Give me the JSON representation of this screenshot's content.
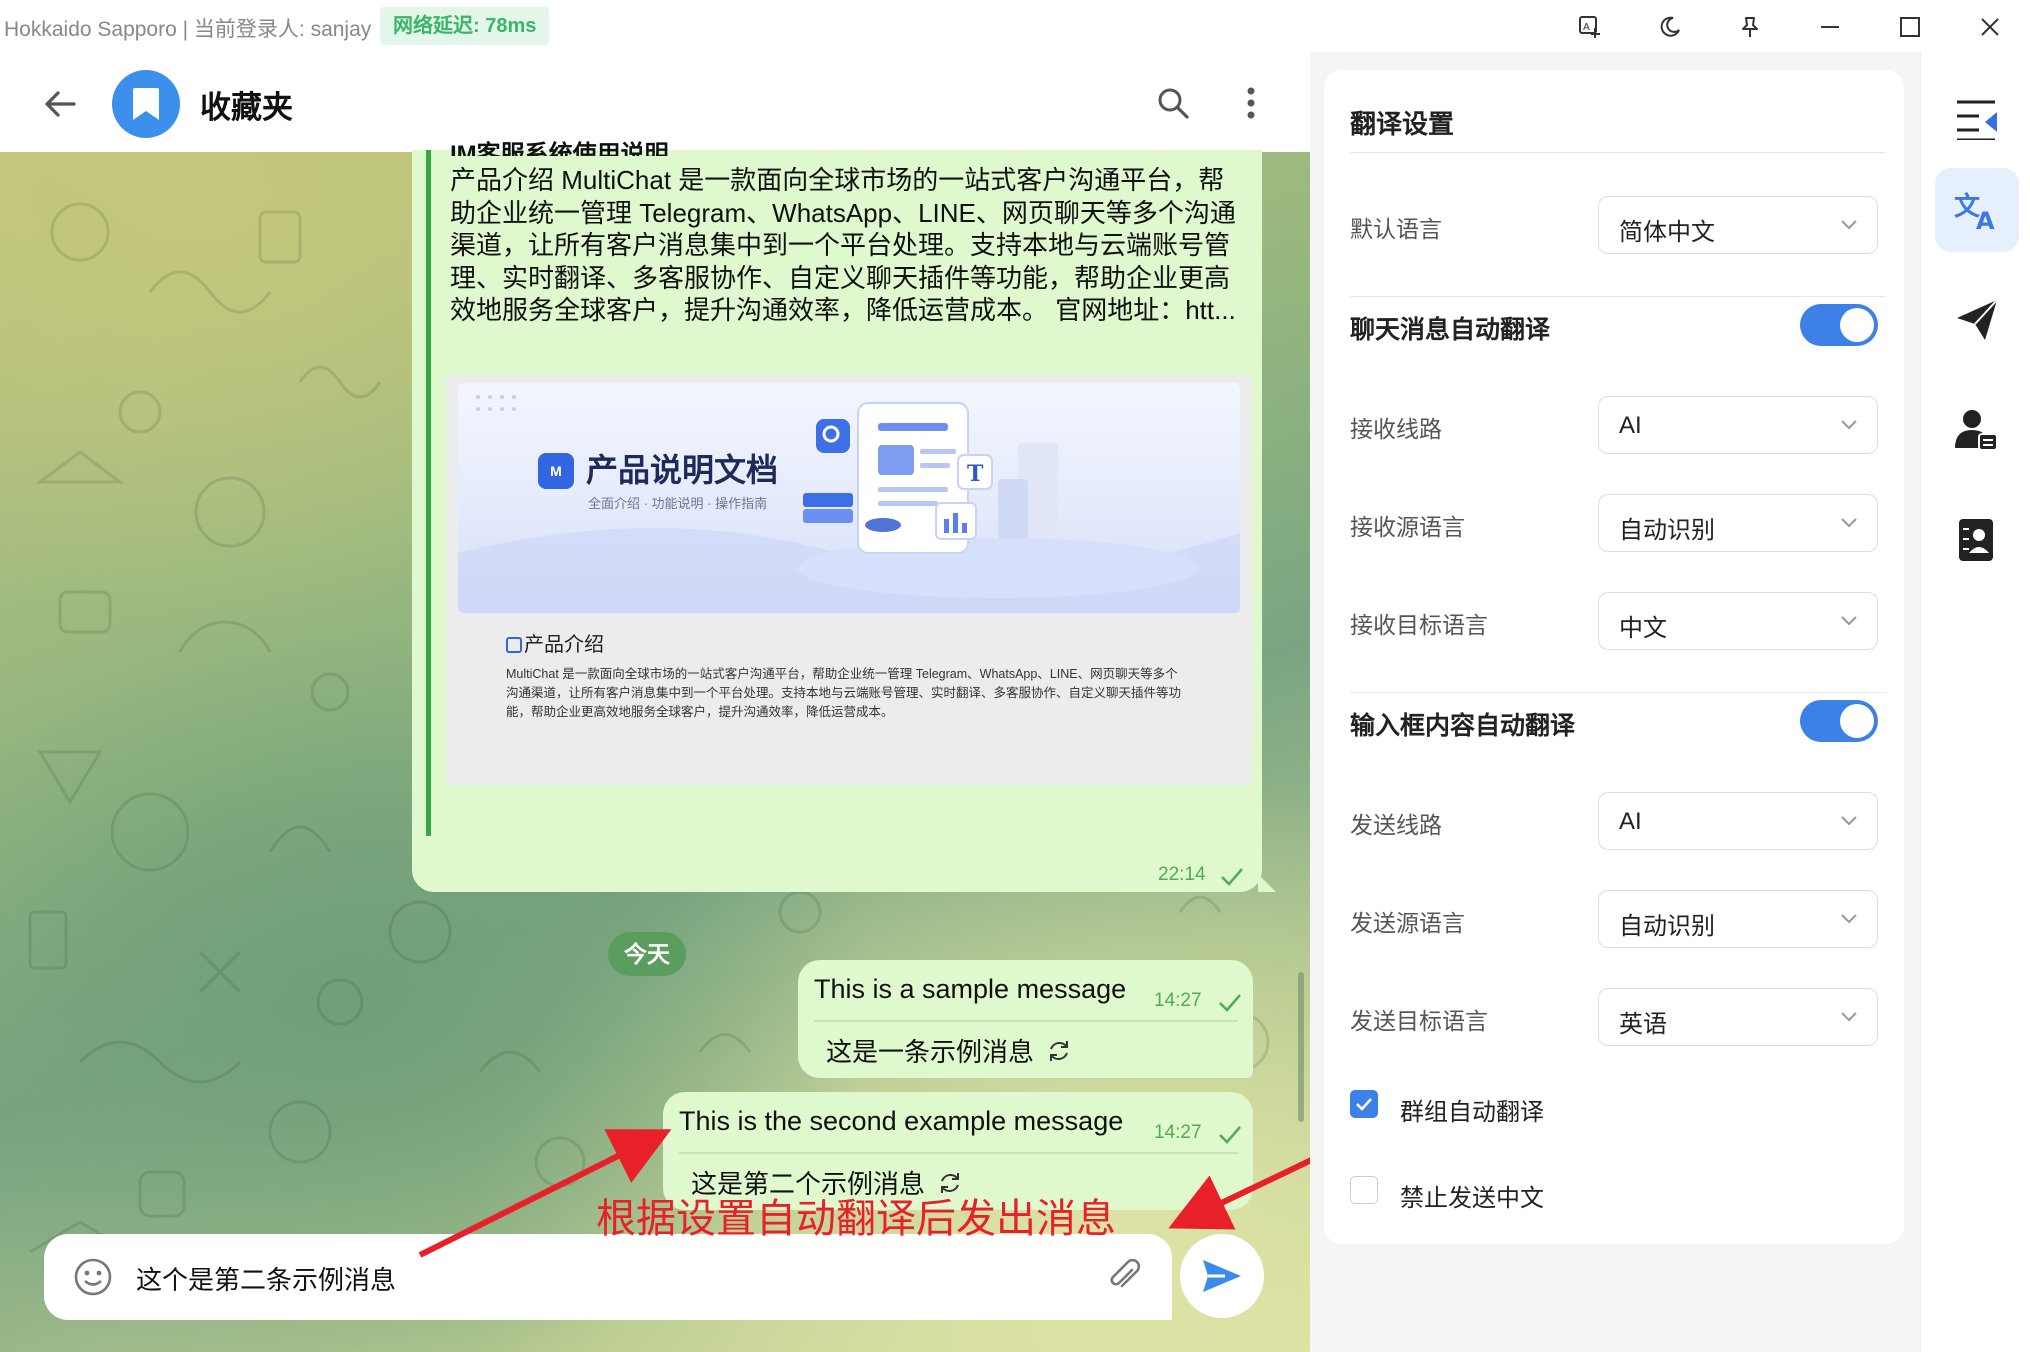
{
  "titlebar": {
    "text": "Hokkaido Sapporo | 当前登录人: sanjay",
    "latency": "网络延迟: 78ms",
    "icons": [
      "translate-window-icon",
      "moon-icon",
      "pin-icon",
      "minimize-icon",
      "maximize-icon",
      "close-icon"
    ]
  },
  "chat": {
    "title": "收藏夹",
    "avatar_icon": "bookmark-icon",
    "header_actions": [
      "search-icon",
      "more-vertical-icon"
    ],
    "pinned_message": {
      "cut_text": "IM客服系统使用说明",
      "text": "产品介绍 MultiChat 是一款面向全球市场的一站式客户沟通平台，帮助企业统一管理 Telegram、WhatsApp、LINE、网页聊天等多个沟通渠道，让所有客户消息集中到一个平台处理。支持本地与云端账号管理、实时翻译、多客服协作、自定义聊天插件等功能，帮助企业更高效地服务全球客户，提升沟通效率，降低运营成本。 官网地址：htt...",
      "doc": {
        "logo": "M",
        "title": "产品说明文档",
        "subtitle": "全面介绍 · 功能说明 · 操作指南",
        "section": "产品介绍",
        "desc": "MultiChat 是一款面向全球市场的一站式客户沟通平台，帮助企业统一管理 Telegram、WhatsApp、LINE、网页聊天等多个沟通渠道，让所有客户消息集中到一个平台处理。支持本地与云端账号管理、实时翻译、多客服协作、自定义聊天插件等功能，帮助企业更高效地服务全球客户，提升沟通效率，降低运营成本。"
      },
      "time": "22:14"
    },
    "date_divider": "今天",
    "messages": [
      {
        "text": "This is a sample message",
        "translation": "这是一条示例消息",
        "time": "14:27"
      },
      {
        "text": "This is the second example message",
        "translation": "这是第二个示例消息",
        "time": "14:27"
      }
    ],
    "input": {
      "value": "这个是第二条示例消息"
    },
    "annotation": "根据设置自动翻译后发出消息"
  },
  "settings": {
    "title": "翻译设置",
    "default_language": {
      "label": "默认语言",
      "value": "简体中文"
    },
    "chat_auto_translate": {
      "label": "聊天消息自动翻译",
      "on": true
    },
    "receive_route": {
      "label": "接收线路",
      "value": "AI"
    },
    "receive_source": {
      "label": "接收源语言",
      "value": "自动识别"
    },
    "receive_target": {
      "label": "接收目标语言",
      "value": "中文"
    },
    "input_auto_translate": {
      "label": "输入框内容自动翻译",
      "on": true
    },
    "send_route": {
      "label": "发送线路",
      "value": "AI"
    },
    "send_source": {
      "label": "发送源语言",
      "value": "自动识别"
    },
    "send_target": {
      "label": "发送目标语言",
      "value": "英语"
    },
    "group_auto_translate": {
      "label": "群组自动翻译",
      "checked": true
    },
    "block_chinese": {
      "label": "禁止发送中文",
      "checked": false
    }
  },
  "rail": {
    "icons": [
      "collapse-panel-icon",
      "translate-icon",
      "send-icon",
      "contact-card-icon",
      "contact-book-icon"
    ],
    "active": "translate-icon"
  },
  "colors": {
    "accent": "#3c80e8",
    "bubble": "#dff8cd",
    "annotation": "#e8202a",
    "latency": "#3cb46b"
  }
}
